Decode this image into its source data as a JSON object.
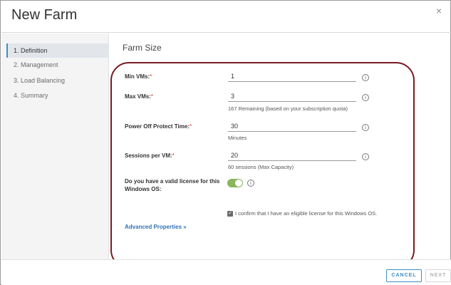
{
  "dialog": {
    "title": "New Farm",
    "close_glyph": "×"
  },
  "sidebar": {
    "steps": [
      {
        "label": "1. Definition",
        "active": true
      },
      {
        "label": "2. Management"
      },
      {
        "label": "3. Load Balancing"
      },
      {
        "label": "4. Summary"
      }
    ]
  },
  "main": {
    "section_title": "Farm Size",
    "fields": {
      "min_vms": {
        "label": "Min VMs:",
        "value": "1"
      },
      "max_vms": {
        "label": "Max VMs:",
        "value": "3",
        "helper": "167 Remaining (based on your subscription quota)"
      },
      "power_off": {
        "label": "Power Off Protect Time:",
        "value": "30",
        "helper": "Minutes"
      },
      "sessions": {
        "label": "Sessions per VM:",
        "value": "20",
        "helper": "60 sessions (Max Capacity)"
      }
    },
    "license": {
      "label_line1": "Do you have a valid license for this",
      "label_line2": "Windows OS:",
      "toggle_on": true,
      "confirm_text": "I confirm that I have an eligible license for this Windows OS.",
      "confirm_checked": true
    },
    "advanced_link": "Advanced Properties »",
    "required_mark": "*",
    "info_glyph": "i"
  },
  "footer": {
    "cancel_label": "CANCEL",
    "next_label": "NEXT"
  },
  "colors": {
    "accent": "#3d8ec3",
    "toggle_on": "#8ab55c",
    "required": "#e0322a",
    "highlight_border": "#7a1a24",
    "link": "#2f73b4"
  }
}
